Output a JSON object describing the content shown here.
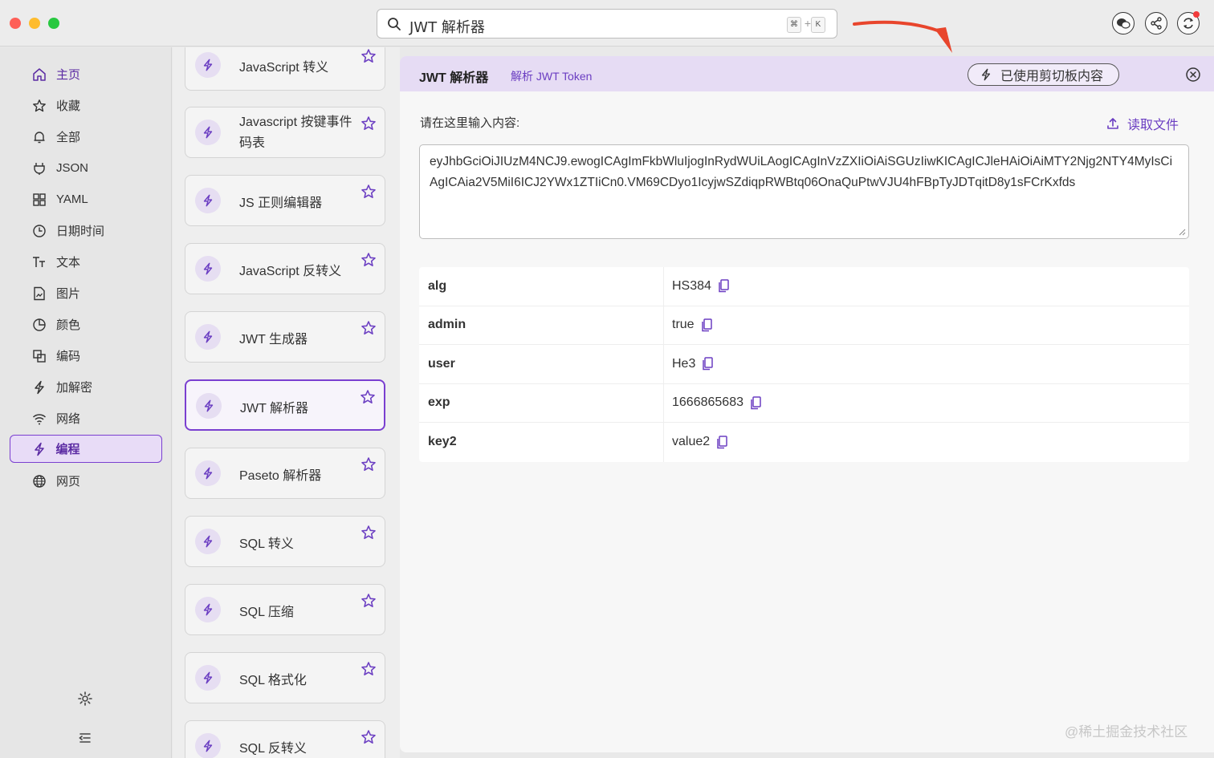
{
  "search": {
    "text": "JWT 解析器",
    "kbd_cmd": "⌘",
    "kbd_plus": "+",
    "kbd_k": "K"
  },
  "sidebar": {
    "items": [
      {
        "label": "主页",
        "icon": "home-icon"
      },
      {
        "label": "收藏",
        "icon": "star-icon"
      },
      {
        "label": "全部",
        "icon": "bell-icon"
      },
      {
        "label": "JSON",
        "icon": "plug-icon"
      },
      {
        "label": "YAML",
        "icon": "grid-icon"
      },
      {
        "label": "日期时间",
        "icon": "clock-icon"
      },
      {
        "label": "文本",
        "icon": "text-icon"
      },
      {
        "label": "图片",
        "icon": "image-file-icon"
      },
      {
        "label": "颜色",
        "icon": "pie-icon"
      },
      {
        "label": "编码",
        "icon": "copy-squares-icon"
      },
      {
        "label": "加解密",
        "icon": "bolt-icon"
      },
      {
        "label": "网络",
        "icon": "wifi-icon"
      },
      {
        "label": "编程",
        "icon": "bolt-icon"
      },
      {
        "label": "网页",
        "icon": "globe-icon"
      }
    ]
  },
  "tools": [
    {
      "label": "JavaScript 转义"
    },
    {
      "label": "Javascript 按键事件码表"
    },
    {
      "label": "JS 正则编辑器"
    },
    {
      "label": "JavaScript 反转义"
    },
    {
      "label": "JWT 生成器"
    },
    {
      "label": "JWT 解析器"
    },
    {
      "label": "Paseto 解析器"
    },
    {
      "label": "SQL 转义"
    },
    {
      "label": "SQL 压缩"
    },
    {
      "label": "SQL 格式化"
    },
    {
      "label": "SQL 反转义"
    }
  ],
  "main": {
    "title": "JWT 解析器",
    "subtitle": "解析 JWT Token",
    "clipboard_label": "已使用剪切板内容",
    "input_label": "请在这里输入内容:",
    "read_file_label": "读取文件",
    "input_value": "eyJhbGciOiJIUzM4NCJ9.ewogICAgImFkbWluIjogInRydWUiLAogICAgInVzZXIiOiAiSGUzIiwKICAgICJleHAiOiAiMTY2Njg2NTY4MyIsCiAgICAia2V5MiI6ICJ2YWx1ZTIiCn0.VM69CDyo1IcyjwSZdiqpRWBtq06OnaQuPtwVJU4hFBpTyJDTqitD8y1sFCrKxfds",
    "rows": [
      {
        "key": "alg",
        "value": "HS384"
      },
      {
        "key": "admin",
        "value": "true"
      },
      {
        "key": "user",
        "value": "He3"
      },
      {
        "key": "exp",
        "value": "1666865683"
      },
      {
        "key": "key2",
        "value": "value2"
      }
    ]
  },
  "watermark": "@稀土掘金技术社区",
  "colors": {
    "accent": "#6b3ec2",
    "header_bg": "#e6dcf4",
    "arrow": "#e8452c"
  }
}
